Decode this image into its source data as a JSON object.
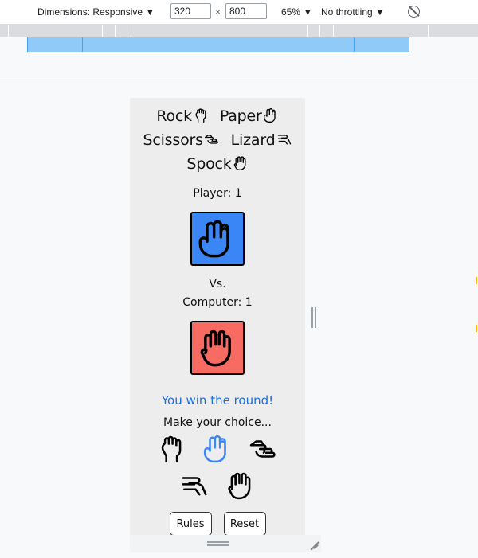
{
  "devtools": {
    "dimensions_label": "Dimensions: Responsive ▼",
    "width_value": "320",
    "times_sign": "×",
    "height_value": "800",
    "zoom_label": "65% ▼",
    "throttle_label": "No throttling ▼"
  },
  "app": {
    "title_words": [
      "Rock",
      "Paper",
      "Scissors",
      "Lizard",
      "Spock"
    ],
    "player_label": "Player: 1",
    "player_card_color": "#3a86f6",
    "vs_label": "Vs.",
    "computer_label": "Computer: 1",
    "computer_card_color": "#f86b62",
    "result_text": "You win the round!",
    "result_color": "#1a6ee8",
    "prompt_text": "Make your choice...",
    "selected_choice_color": "#3a86f6",
    "choices": [
      {
        "name": "rock",
        "icon": "fist-icon",
        "selected": false
      },
      {
        "name": "paper",
        "icon": "open-hand-icon",
        "selected": true
      },
      {
        "name": "scissors",
        "icon": "pointing-hand-icon",
        "selected": false
      },
      {
        "name": "lizard",
        "icon": "lizard-hand-icon",
        "selected": false
      },
      {
        "name": "spock",
        "icon": "vulcan-salute-icon",
        "selected": false
      }
    ],
    "buttons": {
      "rules": "Rules",
      "reset": "Reset"
    }
  }
}
